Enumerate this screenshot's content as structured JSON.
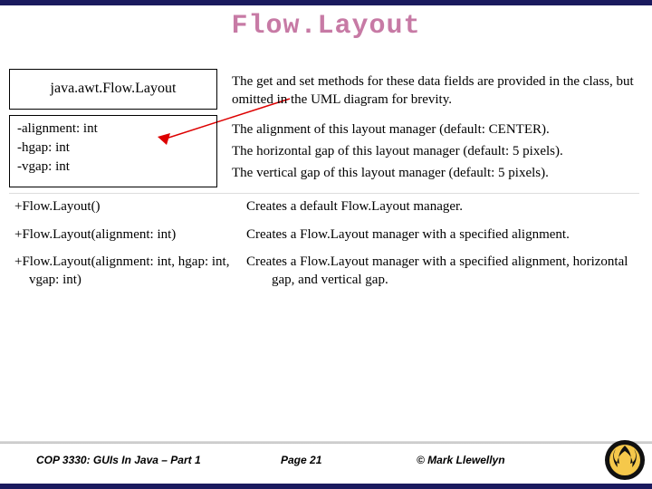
{
  "title": "Flow.Layout",
  "note_text": "The get and set methods for these data fields are provided in the class, but omitted in the UML diagram for brevity.",
  "uml": {
    "classname": "java.awt.Flow.Layout",
    "fields": [
      {
        "sig": "-alignment: int",
        "desc": "The alignment of this layout manager (default: CENTER)."
      },
      {
        "sig": "-hgap: int",
        "desc": "The horizontal gap of this layout manager (default: 5 pixels)."
      },
      {
        "sig": "-vgap: int",
        "desc": "The vertical gap of this layout manager (default: 5 pixels)."
      }
    ],
    "constructors": [
      {
        "sig": "+Flow.Layout()",
        "desc": "Creates a default Flow.Layout manager."
      },
      {
        "sig": "+Flow.Layout(alignment: int)",
        "desc": "Creates a Flow.Layout manager with a specified alignment."
      },
      {
        "sig": "+Flow.Layout(alignment: int, hgap: int, vgap: int)",
        "desc": "Creates a Flow.Layout manager with a specified alignment, horizontal gap, and vertical gap."
      }
    ]
  },
  "footer": {
    "course": "COP 3330: GUIs In Java – Part 1",
    "page": "Page 21",
    "copyright": "© Mark Llewellyn"
  }
}
